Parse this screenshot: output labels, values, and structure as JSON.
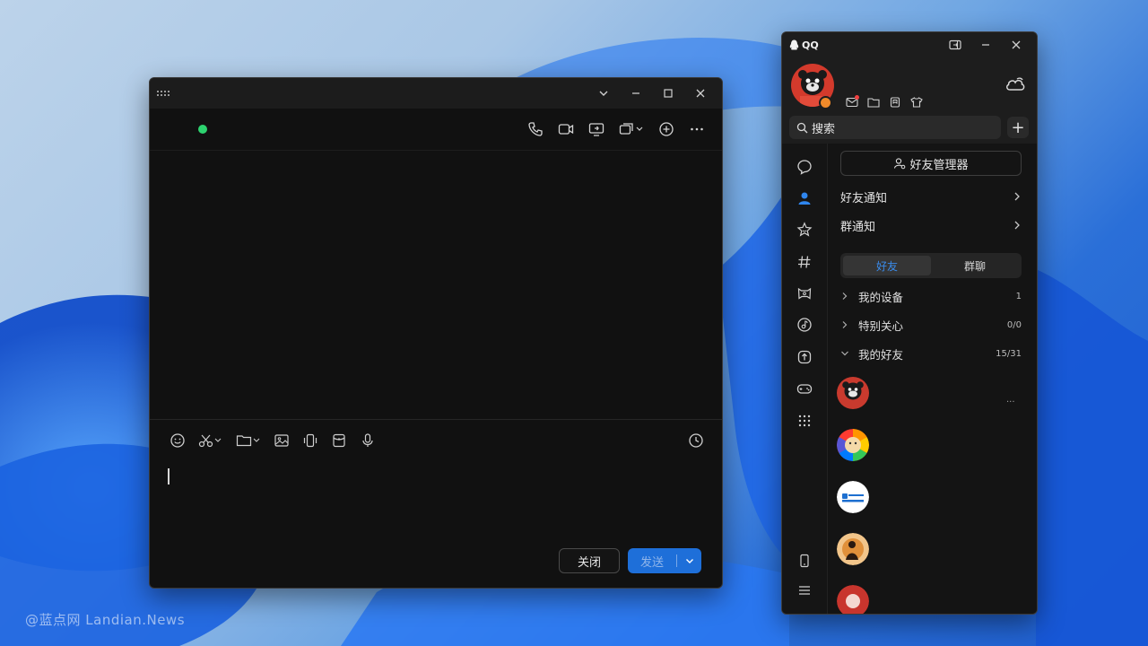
{
  "watermark": "@蓝点网 Landian.News",
  "chat_window": {
    "header_icons": [
      "phone-icon",
      "video-icon",
      "screen-share-icon",
      "remote-assist-icon",
      "add-circle-icon",
      "more-icon"
    ],
    "toolbar_icons": [
      "emoji-icon",
      "scissors-icon",
      "folder-icon",
      "image-icon",
      "shake-icon",
      "red-packet-icon",
      "mic-icon",
      "history-icon"
    ],
    "close_label": "关闭",
    "send_label": "发送"
  },
  "qq": {
    "app_name": "QQ",
    "search_placeholder": "搜索",
    "friend_manager_label": "好友管理器",
    "friend_notice_label": "好友通知",
    "group_notice_label": "群通知",
    "tabs": [
      {
        "label": "好友",
        "active": true
      },
      {
        "label": "群聊",
        "active": false
      }
    ],
    "groups": [
      {
        "name": "我的设备",
        "count": "1",
        "expanded": false
      },
      {
        "name": "特别关心",
        "count": "0/0",
        "expanded": false
      },
      {
        "name": "我的好友",
        "count": "15/31",
        "expanded": true
      }
    ],
    "friend_more": "...",
    "sidebar_icons": [
      "message-icon",
      "contacts-icon",
      "star-space-icon",
      "channel-icon",
      "game-center-icon",
      "music-icon",
      "upload-icon",
      "gamepad-icon",
      "apps-grid-icon",
      "phone-device-icon",
      "menu-icon"
    ]
  },
  "colors": {
    "accent": "#1e6fd9",
    "online": "#2dd36f",
    "active_tab_text": "#3a8bea"
  }
}
